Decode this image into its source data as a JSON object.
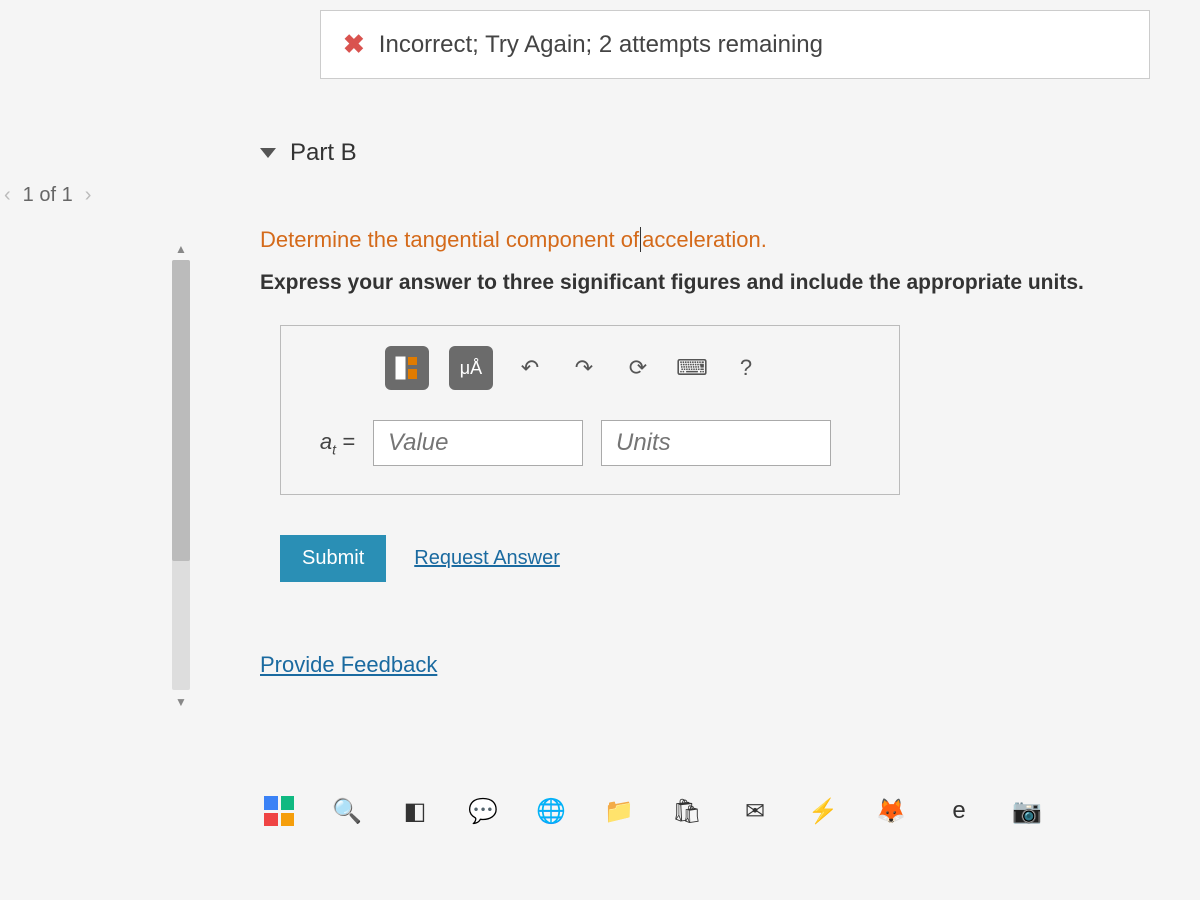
{
  "page_counter": {
    "label": "1 of 1"
  },
  "feedback_banner": {
    "text": "Incorrect; Try Again; 2 attempts remaining"
  },
  "part": {
    "title": "Part B"
  },
  "question": {
    "prompt": "Determine the tangential component of acceleration.",
    "instructions": "Express your answer to three significant figures and include the appropriate units."
  },
  "toolbar": {
    "template": "template",
    "units_symbol": "μÅ",
    "undo": "↶",
    "redo": "↷",
    "reset": "⟳",
    "keyboard": "⌨",
    "help": "?"
  },
  "answer": {
    "variable_html": "a<sub>t</sub> =",
    "value_placeholder": "Value",
    "units_placeholder": "Units"
  },
  "buttons": {
    "submit": "Submit",
    "request_answer": "Request Answer"
  },
  "provide_feedback": "Provide Feedback",
  "taskbar": {
    "search": "🔍",
    "task_view": "◧",
    "chat": "💬",
    "chrome": "🌐",
    "files": "📁",
    "store": "🛍",
    "mail": "✉",
    "app1": "⚡",
    "firefox": "🦊",
    "edge": "e",
    "camera": "📷"
  }
}
